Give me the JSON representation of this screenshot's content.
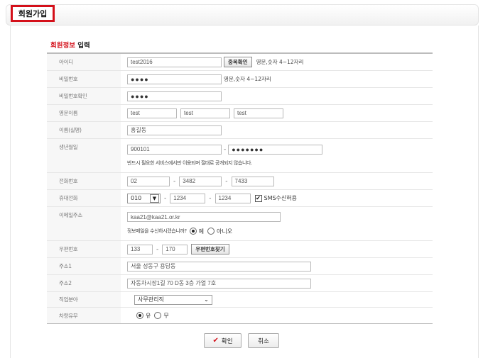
{
  "page": {
    "title": "회원가입"
  },
  "section": {
    "title_red": "회원정보",
    "title_rest": "입력"
  },
  "labels": {
    "userid": "아이디",
    "password": "비밀번호",
    "password_confirm": "비밀번호확인",
    "english_name": "영문이름",
    "name": "이름(실명)",
    "birth": "생년월일",
    "phone": "전화번호",
    "mobile": "휴대전화",
    "email": "이메일주소",
    "zipcode": "우편번호",
    "address1": "주소1",
    "address2": "주소2",
    "job": "직업분야",
    "car": "차량유무"
  },
  "fields": {
    "userid": "test2016",
    "dup_check_button": "중복확인",
    "userid_help": "영문,숫자 4~12자리",
    "password_dots": "●●●●",
    "password_help": "영문,숫자 4~12자리",
    "password_confirm_dots": "●●●●",
    "english_name": [
      "test",
      "test",
      "test"
    ],
    "name": "홍길동",
    "birth_front": "900101",
    "birth_back_dots": "●●●●●●●",
    "birth_note": "반드시 필요한 서비스에서만 이용되며 절대로 공개되지 않습니다.",
    "phone": [
      "02",
      "3482",
      "7433"
    ],
    "mobile_prefix": "010",
    "mobile": [
      "1234",
      "1234"
    ],
    "sms_check": "✔",
    "sms_label": "SMS수신허용",
    "email": "kaa21@kaa21.or.kr",
    "email_question": "정보메일을 수신하시겠습니까?",
    "email_yes": "예",
    "email_no": "아니오",
    "zip": [
      "133",
      "170"
    ],
    "zip_button": "우편번호찾기",
    "address1": "서울 성동구 용답동",
    "address2": "자동차시장1길 70 D동 3층 가열 7호",
    "job": "사무관리직",
    "car_yes": "유",
    "car_no": "무"
  },
  "buttons": {
    "confirm": "확인",
    "cancel": "취소"
  },
  "icons": {
    "confirm": "check-icon",
    "select": "chevron-down-icon"
  },
  "colors": {
    "accent": "#d4101a",
    "label_bg": "#f7f7f7",
    "border": "#bcbcbc"
  }
}
